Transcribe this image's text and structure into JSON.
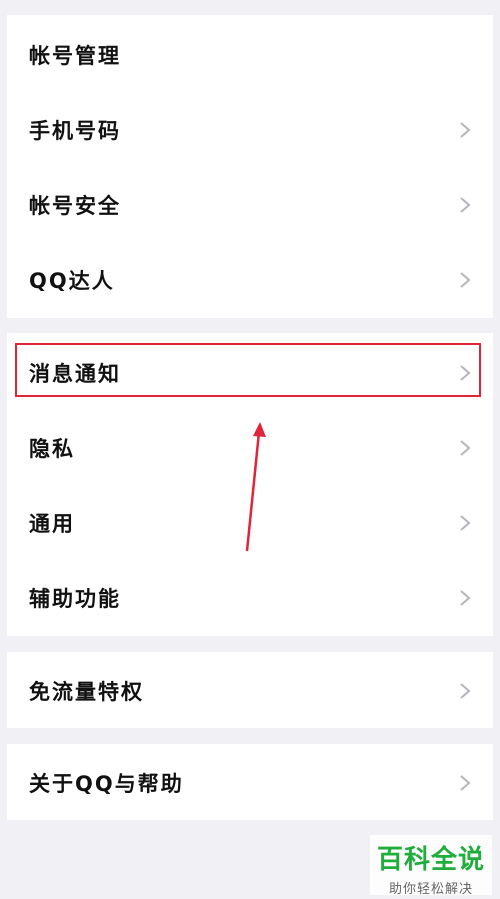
{
  "settings": {
    "account_group": [
      {
        "label": "帐号管理",
        "has_chevron": false
      },
      {
        "label": "手机号码",
        "has_chevron": true
      },
      {
        "label": "帐号安全",
        "has_chevron": true
      },
      {
        "label": "QQ达人",
        "has_chevron": true
      }
    ],
    "general_group": [
      {
        "label": "消息通知",
        "has_chevron": true,
        "highlighted": true
      },
      {
        "label": "隐私",
        "has_chevron": true
      },
      {
        "label": "通用",
        "has_chevron": true
      },
      {
        "label": "辅助功能",
        "has_chevron": true
      }
    ],
    "traffic_group": [
      {
        "label": "免流量特权",
        "has_chevron": true
      }
    ],
    "about_group": [
      {
        "label": "关于QQ与帮助",
        "has_chevron": true
      }
    ]
  },
  "annotation": {
    "highlight_color": "#e0243a",
    "arrow_color": "#e0243a"
  },
  "watermark": {
    "title": "百科全说",
    "subtitle": "助你轻松解决",
    "title_color": "#1fae3b"
  },
  "icons": {
    "chevron": "chevron-right-icon"
  }
}
